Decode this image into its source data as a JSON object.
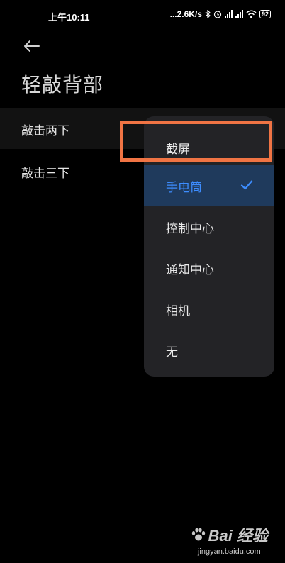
{
  "status_bar": {
    "time": "上午10:11",
    "net_speed": "...2.6K/s",
    "battery": "92"
  },
  "header": {
    "back_icon": "arrow-left-icon",
    "title": "轻敲背部"
  },
  "settings": [
    {
      "label": "敲击两下"
    },
    {
      "label": "敲击三下"
    }
  ],
  "menu": {
    "items": [
      {
        "label": "截屏",
        "selected": false
      },
      {
        "label": "手电筒",
        "selected": true
      },
      {
        "label": "控制中心",
        "selected": false
      },
      {
        "label": "通知中心",
        "selected": false
      },
      {
        "label": "相机",
        "selected": false
      },
      {
        "label": "无",
        "selected": false
      }
    ],
    "accent_color": "#3d8dff",
    "highlight_color": "#f07444"
  },
  "watermark": {
    "logo": "Bai 经验",
    "url": "jingyan.baidu.com"
  }
}
